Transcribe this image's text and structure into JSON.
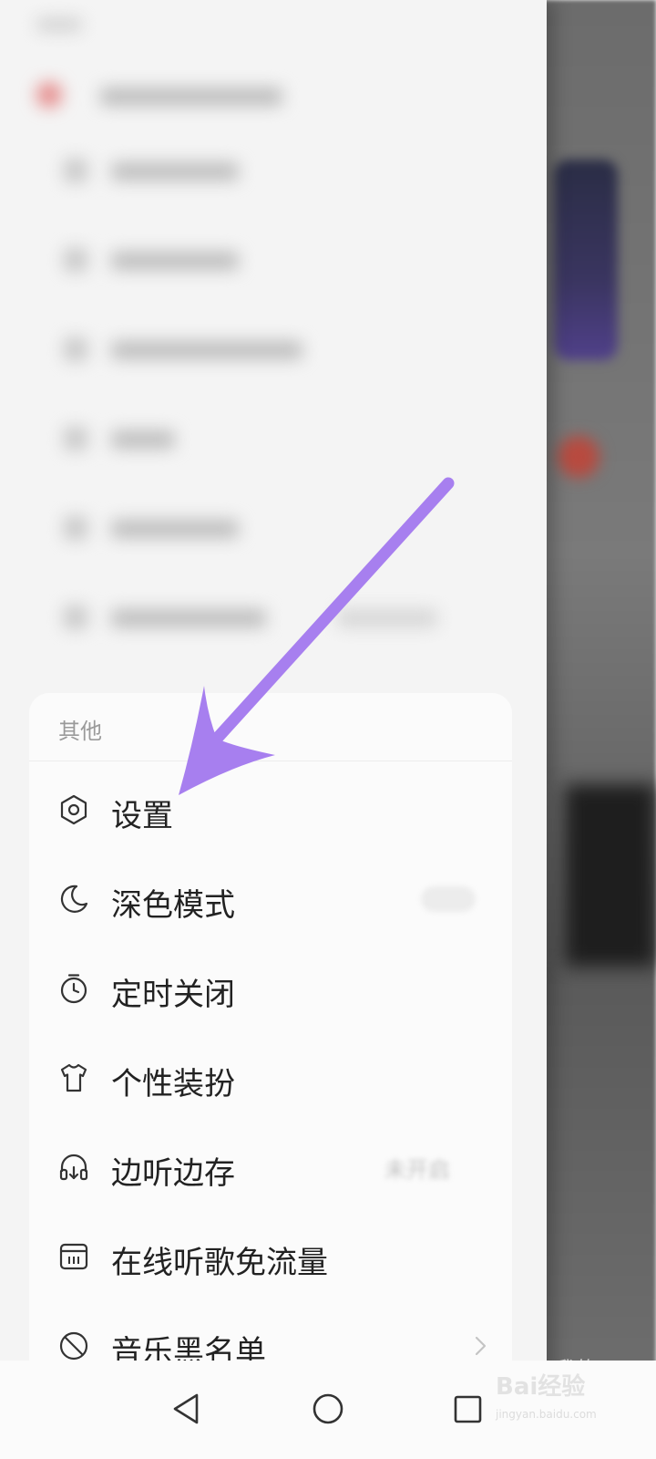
{
  "drawer": {
    "section_title": "其他",
    "items": [
      {
        "label": "设置",
        "icon": "settings-icon",
        "value": ""
      },
      {
        "label": "深色模式",
        "icon": "moon-icon",
        "value": ""
      },
      {
        "label": "定时关闭",
        "icon": "timer-icon",
        "value": ""
      },
      {
        "label": "个性装扮",
        "icon": "tshirt-icon",
        "value": ""
      },
      {
        "label": "边听边存",
        "icon": "headphones-icon",
        "value": "未开启"
      },
      {
        "label": "在线听歌免流量",
        "icon": "sim-card-icon",
        "value": ""
      },
      {
        "label": "音乐黑名单",
        "icon": "block-icon",
        "value": ""
      }
    ]
  },
  "background": {
    "tab_label": "我的"
  },
  "navbar": {
    "buttons": [
      "back-icon",
      "home-icon",
      "recents-icon"
    ]
  },
  "annotation": {
    "arrow_color": "#a77fef"
  },
  "watermark": {
    "text": "Bai经验",
    "url": "jingyan.baidu.com"
  }
}
